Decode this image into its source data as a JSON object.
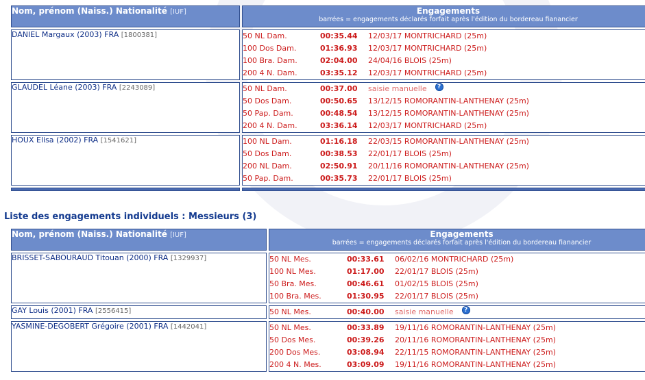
{
  "header": {
    "col_name": "Nom, prénom (Naiss.) Nationalité",
    "col_iuf": "[IUF]",
    "col_eng_title": "Engagements",
    "col_eng_note": "barrées = engagements déclarés forfait après l'édition du bordereau fianancier"
  },
  "dames": [
    {
      "name": "DANIEL Margaux (2003) FRA",
      "iuf": "[1800381]",
      "events": [
        {
          "event": "50 NL Dam.",
          "time": "00:35.44",
          "info": "12/03/17 MONTRICHARD (25m)"
        },
        {
          "event": "100 Dos Dam.",
          "time": "01:36.93",
          "info": "12/03/17 MONTRICHARD (25m)"
        },
        {
          "event": "100 Bra. Dam.",
          "time": "02:04.00",
          "info": "24/04/16 BLOIS (25m)"
        },
        {
          "event": "200 4 N. Dam.",
          "time": "03:35.12",
          "info": "12/03/17 MONTRICHARD (25m)"
        }
      ]
    },
    {
      "name": "GLAUDEL Léane (2003) FRA",
      "iuf": "[2243089]",
      "events": [
        {
          "event": "50 NL Dam.",
          "time": "00:37.00",
          "info": "saisie manuelle",
          "manual": true,
          "help": "?"
        },
        {
          "event": "50 Dos Dam.",
          "time": "00:50.65",
          "info": "13/12/15 ROMORANTIN-LANTHENAY (25m)"
        },
        {
          "event": "50 Pap. Dam.",
          "time": "00:48.54",
          "info": "13/12/15 ROMORANTIN-LANTHENAY (25m)"
        },
        {
          "event": "200 4 N. Dam.",
          "time": "03:36.14",
          "info": "12/03/17 MONTRICHARD (25m)"
        }
      ]
    },
    {
      "name": "HOUX Elisa (2002) FRA",
      "iuf": "[1541621]",
      "events": [
        {
          "event": "100 NL Dam.",
          "time": "01:16.18",
          "info": "22/03/15 ROMORANTIN-LANTHENAY (25m)"
        },
        {
          "event": "50 Dos Dam.",
          "time": "00:38.53",
          "info": "22/01/17 BLOIS (25m)"
        },
        {
          "event": "200 NL Dam.",
          "time": "02:50.91",
          "info": "20/11/16 ROMORANTIN-LANTHENAY (25m)"
        },
        {
          "event": "50 Pap. Dam.",
          "time": "00:35.73",
          "info": "22/01/17 BLOIS (25m)"
        }
      ]
    }
  ],
  "section_title": "Liste des engagements individuels : Messieurs (3)",
  "messieurs": [
    {
      "name": "BRISSET-SABOURAUD Titouan (2000) FRA",
      "iuf": "[1329937]",
      "events": [
        {
          "event": "50 NL Mes.",
          "time": "00:33.61",
          "info": "06/02/16 MONTRICHARD (25m)"
        },
        {
          "event": "100 NL Mes.",
          "time": "01:17.00",
          "info": "22/01/17 BLOIS (25m)"
        },
        {
          "event": "50 Bra. Mes.",
          "time": "00:46.61",
          "info": "01/02/15 BLOIS (25m)"
        },
        {
          "event": "100 Bra. Mes.",
          "time": "01:30.95",
          "info": "22/01/17 BLOIS (25m)"
        }
      ]
    },
    {
      "name": "GAY Louis (2001) FRA",
      "iuf": "[2556415]",
      "events": [
        {
          "event": "50 NL Mes.",
          "time": "00:40.00",
          "info": "saisie manuelle",
          "manual": true,
          "help": "?"
        }
      ]
    },
    {
      "name": "YASMINE-DEGOBERT Grégoire (2001) FRA",
      "iuf": "[1442041]",
      "events": [
        {
          "event": "50 NL Mes.",
          "time": "00:33.89",
          "info": "19/11/16 ROMORANTIN-LANTHENAY (25m)"
        },
        {
          "event": "50 Dos Mes.",
          "time": "00:39.26",
          "info": "20/11/16 ROMORANTIN-LANTHENAY (25m)"
        },
        {
          "event": "200 Dos Mes.",
          "time": "03:08.94",
          "info": "22/11/15 ROMORANTIN-LANTHENAY (25m)"
        },
        {
          "event": "200 4 N. Mes.",
          "time": "03:09.09",
          "info": "19/11/16 ROMORANTIN-LANTHENAY (25m)"
        }
      ]
    }
  ],
  "colors": {
    "header_bg": "#6d8ccb",
    "border": "#314f8f",
    "time_red": "#cc1b1b",
    "name_blue": "#0d2d86"
  }
}
